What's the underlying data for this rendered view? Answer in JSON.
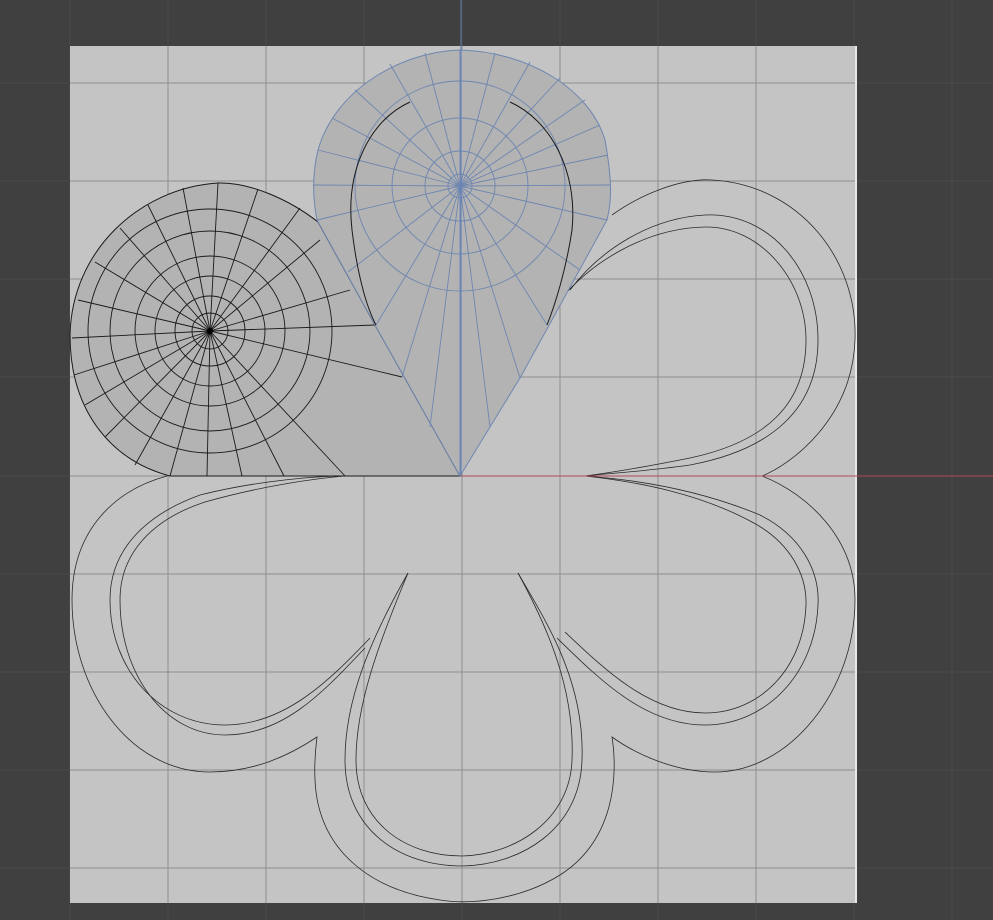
{
  "editor": {
    "background_color": "#404040",
    "canvas_color": "#c4c4c4",
    "grid_color": "#8e8e8e",
    "outer_grid_color": "#4a4a4a",
    "axis_y_color": "#5f7fb8",
    "axis_x_color": "#b04a55",
    "mesh_selected_color": "#6f86b0",
    "mesh_color": "#1a1a1a",
    "mesh_fill_color": "#b3b3b3",
    "outline_color": "#2a2a2a"
  }
}
